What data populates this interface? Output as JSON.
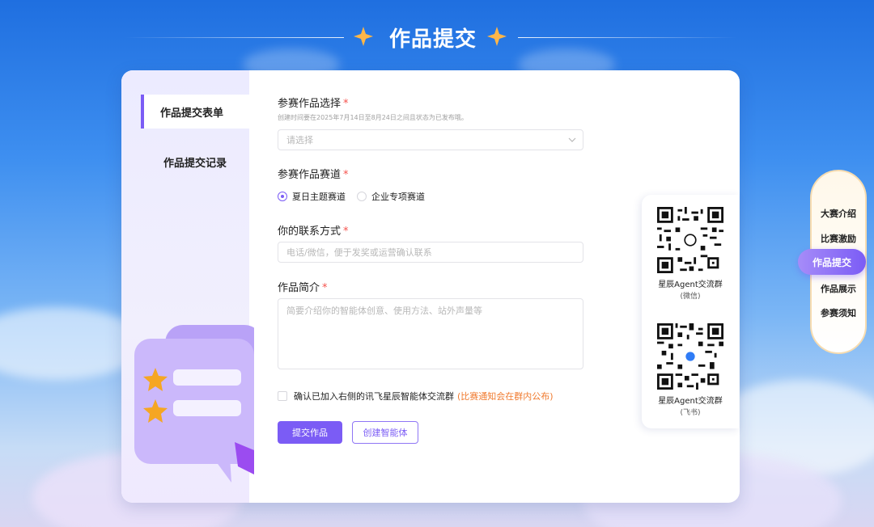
{
  "header": {
    "title": "作品提交"
  },
  "sidebar": {
    "items": [
      {
        "label": "作品提交表单",
        "active": true
      },
      {
        "label": "作品提交记录",
        "active": false
      }
    ]
  },
  "form": {
    "work_select": {
      "label": "参赛作品选择",
      "required_mark": "*",
      "hint": "创建时间要在2025年7月14日至8月24日之间且状态为已发布哦。",
      "placeholder": "请选择"
    },
    "track": {
      "label": "参赛作品赛道",
      "required_mark": "*",
      "options": [
        {
          "label": "夏日主题赛道",
          "selected": true
        },
        {
          "label": "企业专项赛道",
          "selected": false
        }
      ]
    },
    "contact": {
      "label": "你的联系方式",
      "required_mark": "*",
      "placeholder": "电话/微信，便于发奖或运营确认联系"
    },
    "intro": {
      "label": "作品简介",
      "required_mark": "*",
      "placeholder": "简要介绍你的智能体创意、使用方法、站外声量等"
    },
    "confirm": {
      "label": "确认已加入右侧的讯飞星辰智能体交流群",
      "note": "(比赛通知会在群内公布)",
      "checked": false
    },
    "buttons": {
      "submit": "提交作品",
      "create": "创建智能体"
    }
  },
  "qr_panel": {
    "items": [
      {
        "caption": "星辰Agent交流群",
        "sub": "(微信)",
        "icon": "wechat-qr-icon"
      },
      {
        "caption": "星辰Agent交流群",
        "sub": "(飞书)",
        "icon": "feishu-qr-icon"
      }
    ]
  },
  "right_nav": {
    "items": [
      "大赛介绍",
      "比赛激励",
      "作品提交",
      "作品展示",
      "参赛须知"
    ],
    "active_index": 2
  },
  "colors": {
    "accent": "#7b5cf5",
    "required": "#f5534d",
    "note": "#f07a2e",
    "star": "#f5a623"
  }
}
